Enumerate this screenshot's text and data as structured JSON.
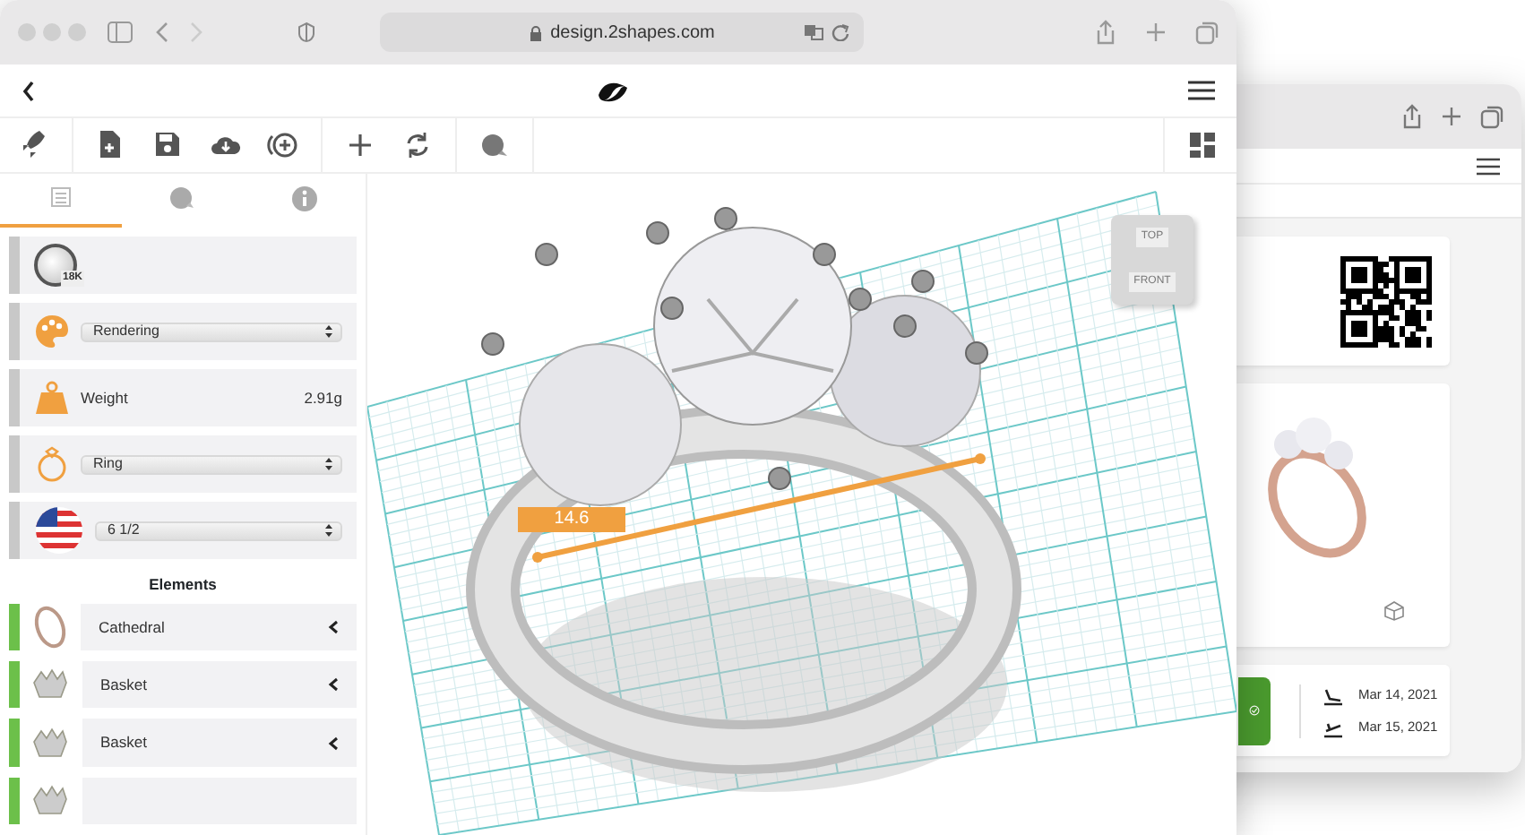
{
  "browser": {
    "address": "design.2shapes.com"
  },
  "sidebar": {
    "tabs": [
      {
        "kind": "list",
        "selected": true
      },
      {
        "kind": "material",
        "selected": false
      },
      {
        "kind": "info",
        "selected": false
      }
    ],
    "properties": [
      {
        "kind": "material",
        "badge": "18K"
      },
      {
        "kind": "select",
        "value": "Rendering"
      },
      {
        "kind": "value",
        "label": "Weight",
        "value": "2.91g"
      },
      {
        "kind": "select",
        "value": "Ring"
      },
      {
        "kind": "select",
        "value": "6 1/2"
      }
    ],
    "elements_heading": "Elements",
    "elements": [
      {
        "kind": "band",
        "label": "Cathedral"
      },
      {
        "kind": "setting",
        "label": "Basket"
      },
      {
        "kind": "setting",
        "label": "Basket"
      },
      {
        "kind": "setting"
      }
    ]
  },
  "viewport": {
    "measurement": "14.6",
    "view_cube": {
      "top": "TOP",
      "front": "FRONT"
    }
  },
  "back_window": {
    "confirmed": true,
    "dates": [
      {
        "kind": "arrival",
        "text": "Mar 14, 2021"
      },
      {
        "kind": "departure",
        "text": "Mar 15, 2021"
      }
    ]
  }
}
